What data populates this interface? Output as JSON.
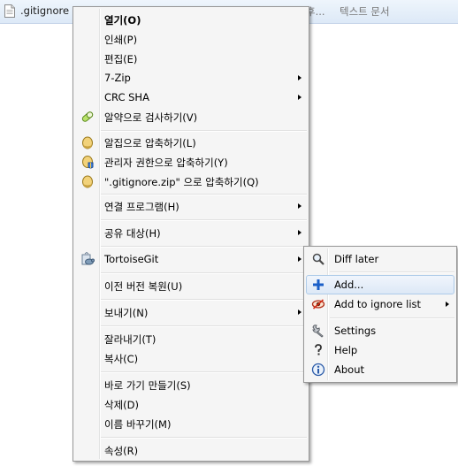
{
  "file": {
    "name": ".gitignore",
    "ellipsis": "후...",
    "type": "텍스트 문서"
  },
  "menu": {
    "open": "열기(O)",
    "print": "인쇄(P)",
    "edit": "편집(E)",
    "sevenzip": "7-Zip",
    "crc_sha": "CRC SHA",
    "ayak_scan": "알약으로 검사하기(V)",
    "alzip_compress": "알집으로 압축하기(L)",
    "admin_compress": "관리자 권한으로 압축하기(Y)",
    "zip_compress": "\".gitignore.zip\" 으로 압축하기(Q)",
    "open_with": "연결 프로그램(H)",
    "share_with": "공유 대상(H)",
    "tortoisegit": "TortoiseGit",
    "restore_previous": "이전 버전 복원(U)",
    "send_to": "보내기(N)",
    "cut": "잘라내기(T)",
    "copy": "복사(C)",
    "create_shortcut": "바로 가기 만들기(S)",
    "delete": "삭제(D)",
    "rename": "이름 바꾸기(M)",
    "properties": "속성(R)"
  },
  "submenu": {
    "diff_later": "Diff later",
    "add": "Add...",
    "add_ignore": "Add to ignore list",
    "settings": "Settings",
    "help": "Help",
    "about": "About"
  },
  "icons": {
    "file": "text-file-icon",
    "ayak": "ayak-pill-icon",
    "alzip": "alzip-egg-icon",
    "admin_alzip": "alzip-admin-icon",
    "zip_alzip": "alzip-egg-icon",
    "tortoisegit": "tortoisegit-icon",
    "diff": "magnifier-icon",
    "add": "plus-icon",
    "ignore": "ignore-eye-icon",
    "settings": "wrench-icon",
    "help": "question-icon",
    "about": "info-icon"
  },
  "colors": {
    "highlight_border": "#aecbe9",
    "highlight_fill": "#dde8f6",
    "add_blue": "#1a5fc8"
  }
}
